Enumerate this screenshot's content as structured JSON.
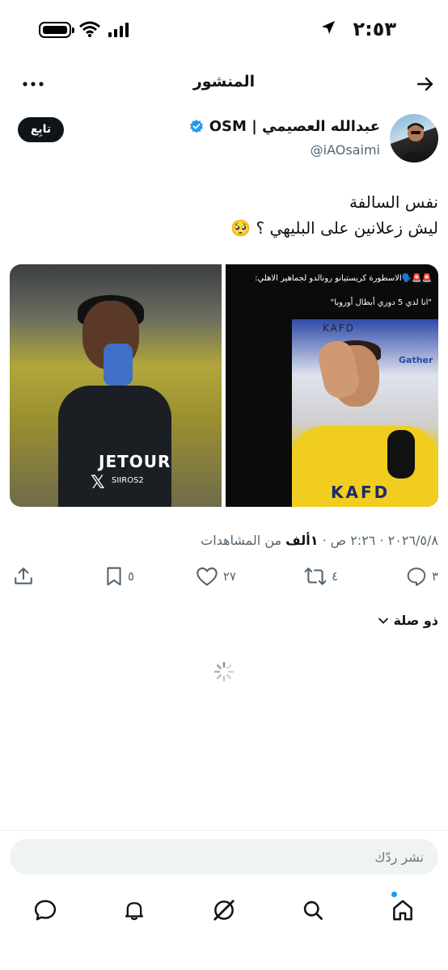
{
  "status_bar": {
    "time": "٢:٥٣"
  },
  "header": {
    "title": "المنشور"
  },
  "author": {
    "name": "عبدالله العصيمي | OSM",
    "handle": "@iAOsaimi",
    "follow_label": "تابِع"
  },
  "tweet": {
    "line1": "نفس السالفة",
    "line2": "ليش زعلانين على البليهي ؟ 🥺"
  },
  "media": {
    "right_caption_1": "🚨🚨🗣️الاسطورة كريستيانو رونالدو لجماهير الاهلي:",
    "right_caption_2": "\"انا لدي 5 دوري أبطال أوروبا\"",
    "left_jersey_text": "JETOUR",
    "left_watermark": "SIIROS2",
    "right_board_text": "KAFD",
    "right_board_text_2": "Gather",
    "right_shirt_text": "KAFD"
  },
  "meta": {
    "date": "٢٠٢٦/٥/٨",
    "time": "٢:٢٦ ص",
    "views_count": "١ألف",
    "views_label": "من المشاهدات"
  },
  "actions": {
    "replies": "٣",
    "reposts": "٤",
    "likes": "٢٧",
    "bookmarks": "٥"
  },
  "related_label": "ذو صلة",
  "reply_bar": {
    "placeholder": "نشر ردّك"
  },
  "colors": {
    "accent": "#1d9bf0",
    "text": "#0f1419",
    "muted": "#536471"
  }
}
